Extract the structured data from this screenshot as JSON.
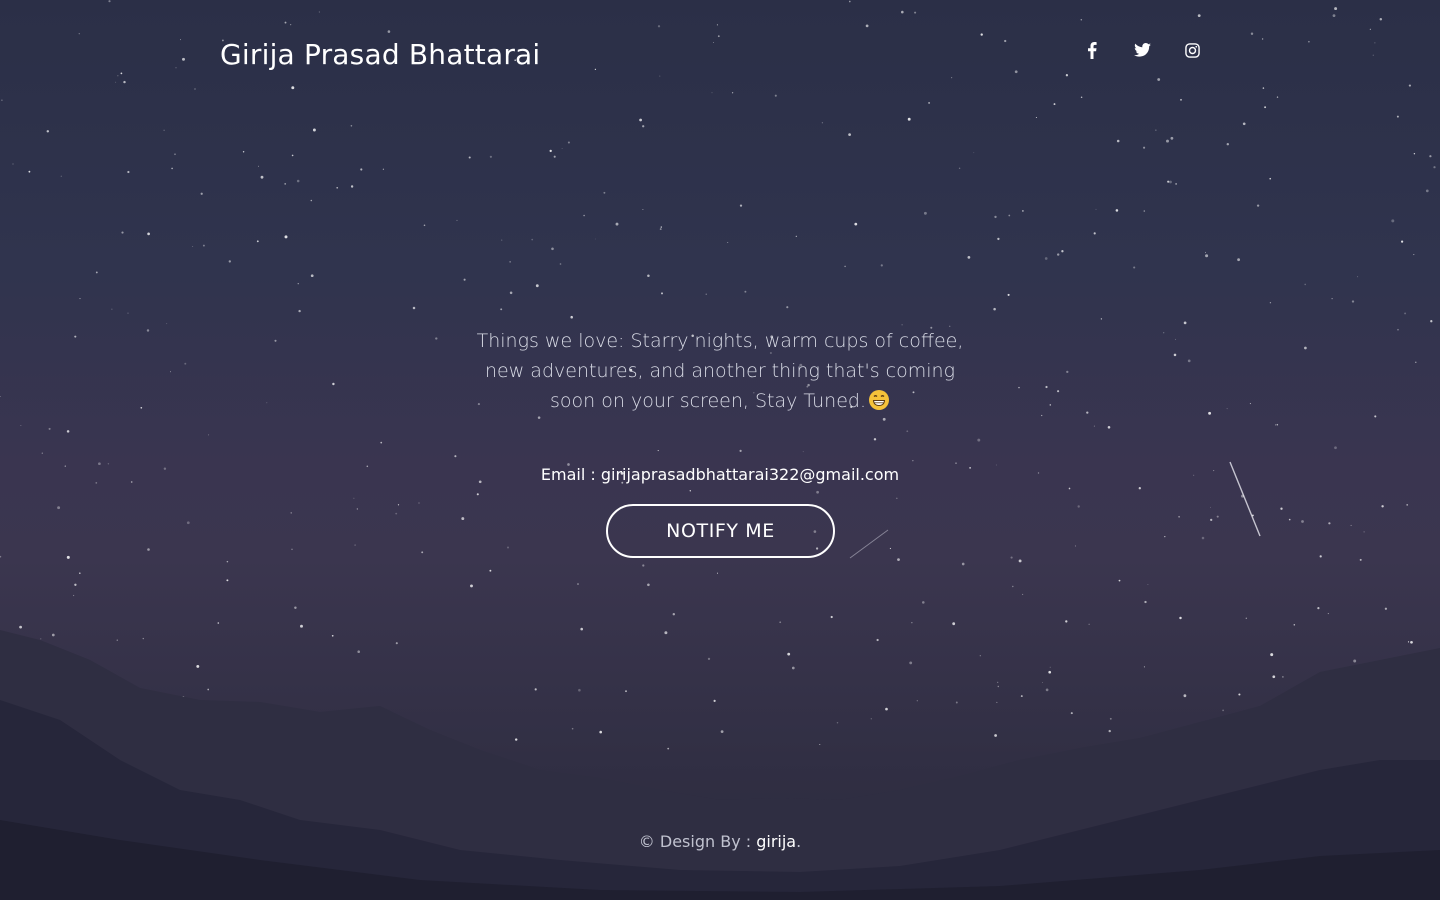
{
  "header": {
    "brand": "Girija Prasad Bhattarai",
    "social": [
      {
        "name": "facebook",
        "icon": "facebook-icon"
      },
      {
        "name": "twitter",
        "icon": "twitter-icon"
      },
      {
        "name": "instagram",
        "icon": "instagram-icon"
      }
    ]
  },
  "main": {
    "tagline": "Things we love: Starry nights, warm cups of coffee, new adventures, and another thing that's coming soon on your screen, Stay Tuned.",
    "tagline_emoji": "grinning-face-emoji",
    "email_label": "Email :",
    "email_value": "girijaprasadbhattarai322@gmail.com",
    "notify_button": "NOTIFY ME"
  },
  "footer": {
    "prefix": "© Design By :",
    "author_link": "girija",
    "suffix": "."
  },
  "colors": {
    "text": "#ffffff",
    "tagline": "#d9dbe6",
    "footer_text": "#c0c2cf",
    "sky_top": "#2b2f47",
    "sky_glow": "#3b364f",
    "mountain": "#252536"
  }
}
